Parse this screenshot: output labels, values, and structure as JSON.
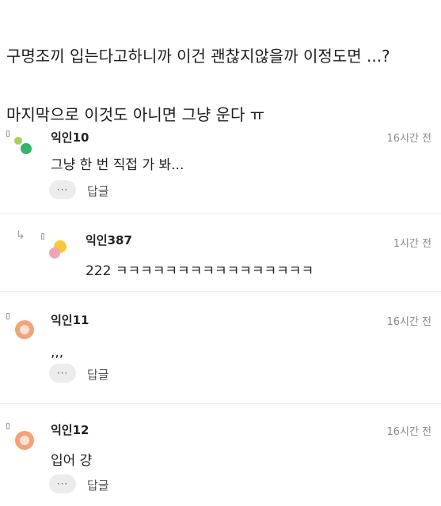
{
  "post": {
    "text_line1": "구명조끼 입는다고하니까 이건 괜찮지않을까 이정도면 ...?",
    "text_line2": "마지막으로 이것도 아니면 그냥 운다 ㅠ"
  },
  "comments": [
    {
      "nick": "익인10",
      "time": "16시간 전",
      "body": "그냥 한 번 직접 가 봐...",
      "more": "···",
      "reply": "답글"
    },
    {
      "nick": "익인387",
      "time": "1시간 전",
      "body": "222 ㅋㅋㅋㅋㅋㅋㅋㅋㅋㅋㅋㅋㅋㅋㅋㅋ"
    },
    {
      "nick": "익인11",
      "time": "16시간 전",
      "body": ",,,",
      "more": "···",
      "reply": "답글"
    },
    {
      "nick": "익인12",
      "time": "16시간 전",
      "body": "입어 걍",
      "more": "···",
      "reply": "답글"
    }
  ],
  "icons": {
    "reply_arrow": "reply-arrow-icon",
    "more": "more-dots-icon"
  },
  "colors": {
    "avatar_green": "#7fc241",
    "avatar_orange": "#f3a27a",
    "avatar_yellow": "#f5c93a",
    "avatar_pink": "#f2a3b4"
  }
}
